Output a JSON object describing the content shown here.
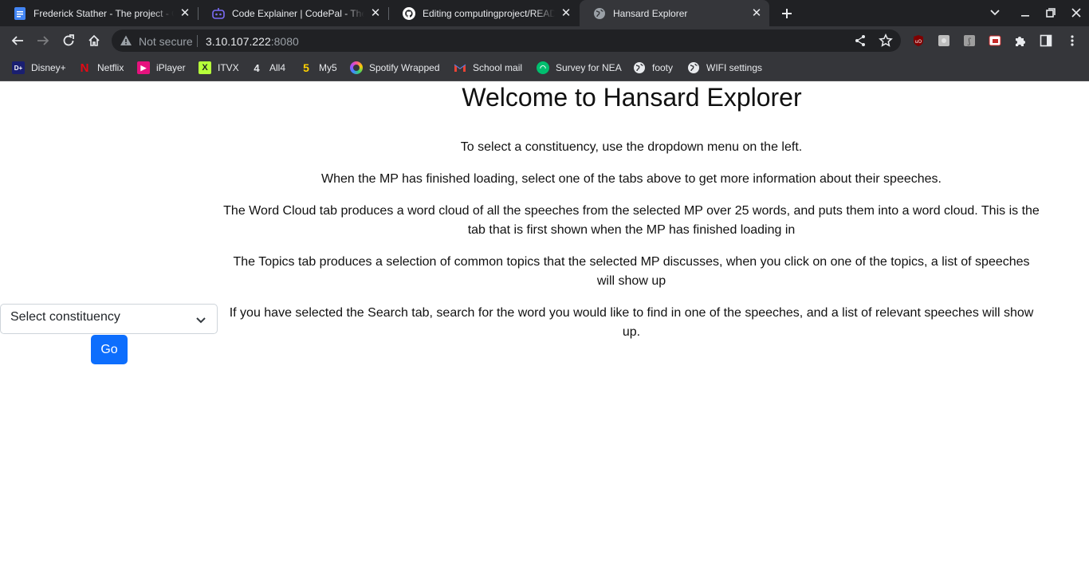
{
  "tabs": [
    {
      "title": "Frederick Stather - The project - Google Docs",
      "icon": "google-docs-icon"
    },
    {
      "title": "Code Explainer | CodePal - The Ultimate Coding Companion",
      "icon": "codepal-icon"
    },
    {
      "title": "Editing computingproject/README.md",
      "icon": "github-icon"
    },
    {
      "title": "Hansard Explorer",
      "icon": "globe-icon",
      "active": true
    }
  ],
  "omnibox": {
    "security_label": "Not secure",
    "host": "3.10.107.222",
    "port": ":8080"
  },
  "bookmarks": [
    {
      "label": "Disney+",
      "icon": "disney-icon"
    },
    {
      "label": "Netflix",
      "icon": "netflix-icon"
    },
    {
      "label": "iPlayer",
      "icon": "iplayer-icon"
    },
    {
      "label": "ITVX",
      "icon": "itvx-icon"
    },
    {
      "label": "All4",
      "icon": "all4-icon"
    },
    {
      "label": "My5",
      "icon": "my5-icon"
    },
    {
      "label": "Spotify Wrapped",
      "icon": "spotify-icon"
    },
    {
      "label": "School mail",
      "icon": "gmail-icon"
    },
    {
      "label": "Survey for NEA",
      "icon": "survey-icon"
    },
    {
      "label": "footy",
      "icon": "globe-icon"
    },
    {
      "label": "WIFI settings",
      "icon": "globe-icon"
    }
  ],
  "page": {
    "heading": "Welcome to Hansard Explorer",
    "paragraphs": [
      "To select a constituency, use the dropdown menu on the left.",
      "When the MP has finished loading, select one of the tabs above to get more information about their speeches.",
      "The Word Cloud tab produces a word cloud of all the speeches from the selected MP over 25 words, and puts them into a word cloud. This is the tab that is first shown when the MP has finished loading in",
      "The Topics tab produces a selection of common topics that the selected MP discusses, when you click on one of the topics, a list of speeches will show up",
      "If you have selected the Search tab, search for the word you would like to find in one of the speeches, and a list of relevant speeches will show up."
    ],
    "select_placeholder": "Select constituency",
    "go_label": "Go"
  },
  "colors": {
    "go_button": "#0d6efd",
    "chrome_dark": "#202124",
    "chrome_toolbar": "#35363a"
  }
}
